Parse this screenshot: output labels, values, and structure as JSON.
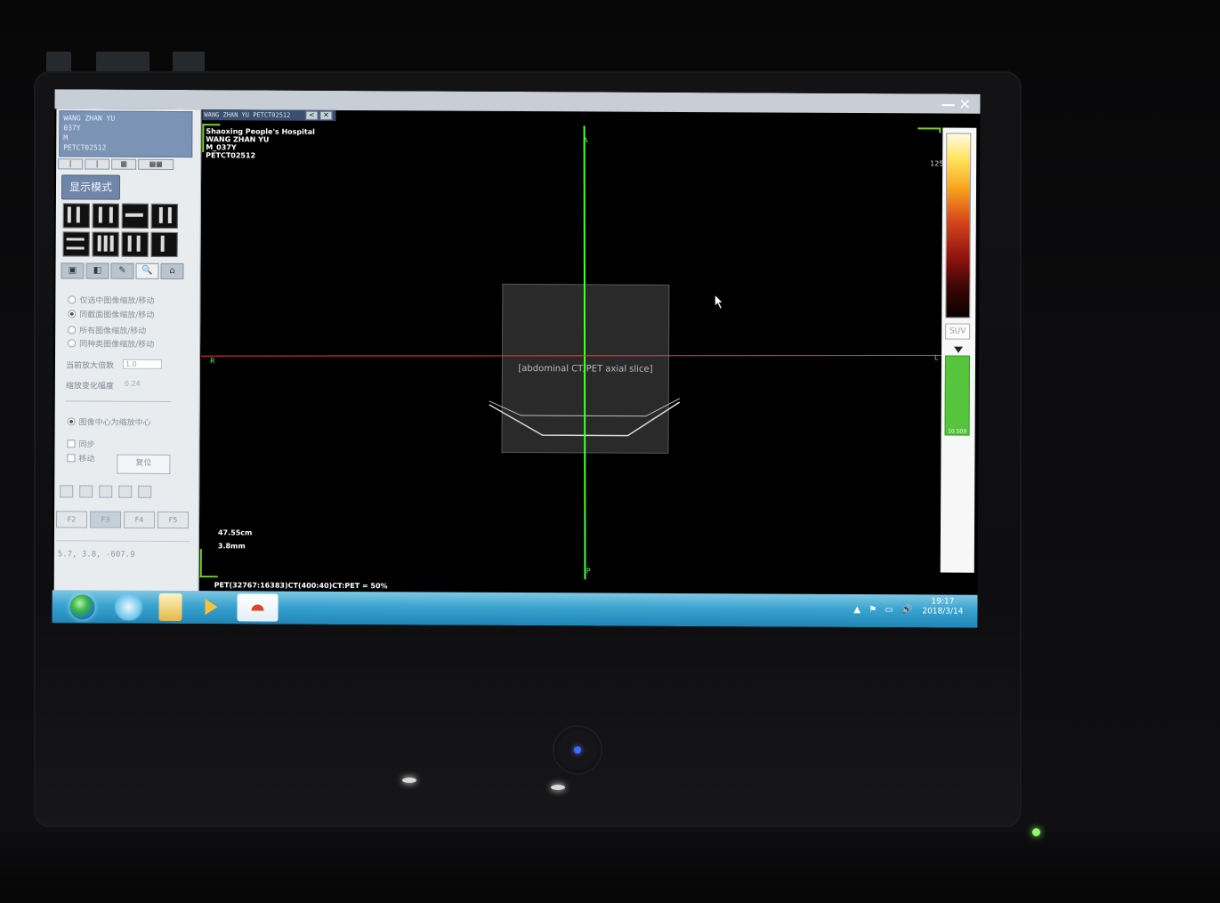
{
  "window": {
    "minimize": "—",
    "close": "✕"
  },
  "patient": {
    "name": "WANG ZHAN YU",
    "line2": "037Y",
    "line3": "M",
    "id": "PETCT02512"
  },
  "layout_buttons": [
    "|",
    "|",
    "▦",
    "▦▦"
  ],
  "display_mode_label": "显示模式",
  "tabs": [
    "▣",
    "◧",
    "✎",
    "🔍",
    "⌂"
  ],
  "options": [
    {
      "label": "仅选中图像缩放/移动",
      "selected": false
    },
    {
      "label": "同截面图像缩放/移动",
      "selected": true
    },
    {
      "label": "所有图像缩放/移动",
      "selected": false
    },
    {
      "label": "同种类图像缩放/移动",
      "selected": false
    }
  ],
  "zoom_factor_label": "当前放大倍数",
  "zoom_factor_value": "1.0",
  "zoom_step_label": "缩放变化幅度",
  "zoom_step_value": "0.24",
  "center_option": "图像中心为缩放中心",
  "sync_label": "同步",
  "move_label": "移动",
  "reset_label": "复位",
  "tools": [
    {
      "label": "F2",
      "active": false
    },
    {
      "label": "F3",
      "active": true
    },
    {
      "label": "F4",
      "active": false
    },
    {
      "label": "F5",
      "active": false
    }
  ],
  "coords": "5.7, 3.8, -607.9",
  "viewer": {
    "tab_title": "WANG ZHAN YU PETCT02512",
    "hospital": "Shaoxing People's Hospital",
    "patient_name": "WANG ZHAN YU",
    "sex_age": "M_037Y",
    "study_id": "PETCT02512",
    "fov": "47.55cm",
    "slice": "3.8mm",
    "label_top": "A",
    "label_bottom": "P",
    "label_left": "R",
    "label_right": "L",
    "status": "PET(32767:16383)CT(400:40)CT:PET = 50%"
  },
  "colorbar": {
    "max": "125",
    "suv_label": "SUV",
    "value": "10.509"
  },
  "taskbar": {
    "time": "19:17",
    "date": "2018/3/14",
    "tray": "▲ ⚑ ▭ 🔊"
  },
  "colors": {
    "crosshair_vertical": "#4dff3a",
    "crosshair_horizontal": "#ff3b2f",
    "accent_green": "#7dcc2e"
  }
}
